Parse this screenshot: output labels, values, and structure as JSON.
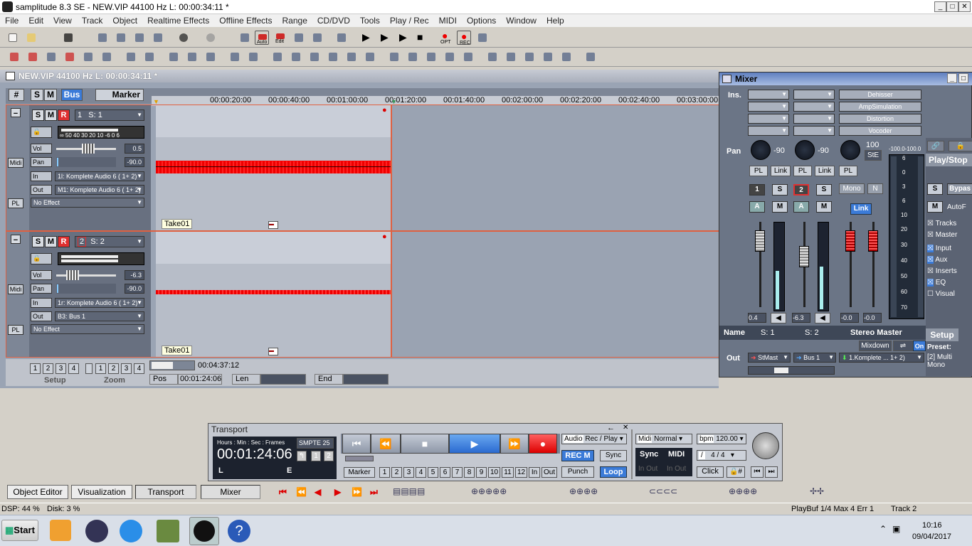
{
  "window": {
    "title": "samplitude 8.3 SE - NEW.VIP   44100 Hz L: 00:00:34:11 *"
  },
  "menu": [
    "File",
    "Edit",
    "View",
    "Track",
    "Object",
    "Realtime Effects",
    "Offline Effects",
    "Range",
    "CD/DVD",
    "Tools",
    "Play / Rec",
    "MIDI",
    "Options",
    "Window",
    "Help"
  ],
  "toolbar": {
    "auto_label": "Auto",
    "edit_label": "Edit",
    "opt_label": "OPT",
    "rec_label": "REC"
  },
  "vip": {
    "title": "NEW.VIP   44100 Hz L: 00:00:34:11 *",
    "header_buttons": {
      "s": "S",
      "m": "M",
      "bus": "Bus",
      "marker": "Marker"
    },
    "ruler": [
      "00:00:20:00",
      "00:00:40:00",
      "00:01:00:00",
      "00:01:20:00",
      "00:01:40:00",
      "00:02:00:00",
      "00:02:20:00",
      "00:02:40:00",
      "00:03:00:00"
    ],
    "tracks": [
      {
        "num": "1",
        "name": "S: 1",
        "vol_label": "Vol",
        "vol": "0.5",
        "pan_label": "Pan",
        "pan": "-90.0",
        "in_label": "In",
        "in": "1l: Komplete Audio 6 ( 1+ 2)",
        "out_label": "Out",
        "out": "M1: Komplete Audio 6 ( 1+ 2)",
        "fx": "No Effect",
        "scale": "∞  50 40 30 20  10 -6   0   6",
        "clip": "Take01",
        "midi": "Midi",
        "pl": "PL"
      },
      {
        "num": "2",
        "name": "S: 2",
        "vol_label": "Vol",
        "vol": "-6.3",
        "pan_label": "Pan",
        "pan": "-90.0",
        "in_label": "In",
        "in": "1r: Komplete Audio 6 ( 1+ 2)",
        "out_label": "Out",
        "out": "B3: Bus 1",
        "fx": "No Effect",
        "scale": "",
        "clip": "Take01",
        "midi": "Midi",
        "pl": "PL"
      }
    ],
    "bottom": {
      "setup": "Setup",
      "zoom": "Zoom",
      "nums": [
        "1",
        "2",
        "3",
        "4"
      ],
      "time": "00:04:37:12",
      "pos_label": "Pos",
      "pos": "00:01:24:06",
      "len_label": "Len",
      "end_label": "End"
    }
  },
  "mixer": {
    "title": "Mixer",
    "ins_label": "Ins.",
    "pan_label": "Pan",
    "name_label": "Name",
    "out_label": "Out",
    "effects": [
      "Dehisser",
      "AmpSimulation",
      "Distortion",
      "Vocoder"
    ],
    "ch1": {
      "pan": "-90",
      "pl": "PL",
      "link": "Link",
      "num": "1",
      "s": "S",
      "a": "A",
      "m": "M",
      "level": "0.4",
      "name": "S: 1",
      "out": "StMast"
    },
    "ch2": {
      "pan": "-90",
      "pl": "PL",
      "link": "Link",
      "num": "2",
      "s": "S",
      "a": "A",
      "m": "M",
      "level": "-6.3",
      "name": "S: 2",
      "out": "Bus 1"
    },
    "master": {
      "pan": "100",
      "ste": "StE",
      "pl": "PL",
      "mono": "Mono",
      "n": "N",
      "link": "Link",
      "l": "-0.0",
      "r": "-0.0",
      "name": "Stereo Master",
      "mixdown": "Mixdown",
      "on": "On",
      "out": "1.Komplete ... 1+ 2)",
      "meter_top": "-100.0-100.0"
    },
    "meter_scale": [
      "6",
      "0",
      "3",
      "6",
      "10",
      "20",
      "30",
      "40",
      "50",
      "60",
      "70"
    ],
    "right": {
      "playstop": "Play/Stop",
      "s": "S",
      "bypass": "Bypas",
      "m": "M",
      "autof": "AutoF",
      "tracks": "Tracks",
      "master": "Master",
      "input": "Input",
      "aux": "Aux",
      "inserts": "Inserts",
      "eq": "EQ",
      "visual": "Visual",
      "setup": "Setup",
      "preset_label": "Preset:",
      "preset": "[2] Multi Mono"
    }
  },
  "transport": {
    "title": "Transport",
    "hms": "Hours : Min : Sec : Frames",
    "smpte": "SMPTE 25",
    "time": "00:01:24:06",
    "l": "L",
    "e": "E",
    "audio": "Audio",
    "recplay": "Rec / Play",
    "recm": "REC M",
    "sync": "Sync",
    "punch": "Punch",
    "loop": "Loop",
    "marker": "Marker",
    "marker_nums": [
      "1",
      "2",
      "3",
      "4",
      "5",
      "6",
      "7",
      "8",
      "9",
      "10",
      "11",
      "12"
    ],
    "in": "In",
    "out": "Out",
    "midi": "Midi",
    "normal": "Normal",
    "sync2": "Sync",
    "midi2": "MIDI",
    "inout1": "In Out",
    "inout2": "In Out",
    "bpm_label": "bpm",
    "bpm": "120.00",
    "sig": "4 / 4",
    "click": "Click"
  },
  "tabs": [
    "Object Editor",
    "Visualization",
    "Transport",
    "Mixer"
  ],
  "status": {
    "dsp": "DSP: 44 %",
    "disk": "Disk: 3 %",
    "playbuf": "PlayBuf 1/4  Max 4  Err 1",
    "track": "Track 2"
  },
  "taskbar": {
    "start": "Start",
    "time": "10:16",
    "date": "09/04/2017"
  }
}
